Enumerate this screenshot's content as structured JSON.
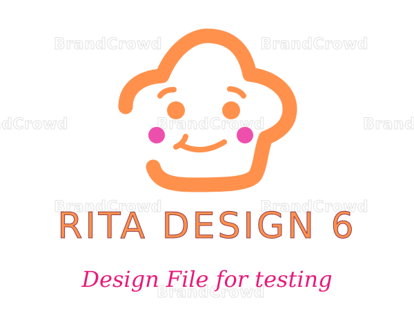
{
  "logo": {
    "title": "RITA DESIGN 6",
    "subtitle": "Design File for testing",
    "icon": "smiling-cloud-face-icon"
  },
  "watermark": "BrandCrowd",
  "colors": {
    "orange": "#ff914d",
    "pink": "#e8197a",
    "cheek": "#ee4fad",
    "outline": "#8b3a4a"
  }
}
